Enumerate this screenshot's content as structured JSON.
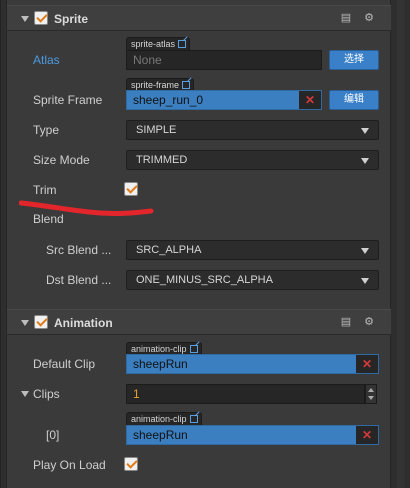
{
  "sprite": {
    "title": "Sprite",
    "book_icon": "book-icon",
    "gear_icon": "gear-icon",
    "atlas": {
      "label": "Atlas",
      "tag": "sprite-atlas",
      "placeholder": "None",
      "button": "选择"
    },
    "sprite_frame": {
      "label": "Sprite Frame",
      "tag": "sprite-frame",
      "value": "sheep_run_0",
      "button": "编辑"
    },
    "type": {
      "label": "Type",
      "value": "SIMPLE"
    },
    "size_mode": {
      "label": "Size Mode",
      "value": "TRIMMED"
    },
    "trim": {
      "label": "Trim",
      "checked": true
    },
    "blend": {
      "label": "Blend"
    },
    "src_blend": {
      "label": "Src Blend ...",
      "value": "SRC_ALPHA"
    },
    "dst_blend": {
      "label": "Dst Blend ...",
      "value": "ONE_MINUS_SRC_ALPHA"
    }
  },
  "animation": {
    "title": "Animation",
    "default_clip": {
      "label": "Default Clip",
      "tag": "animation-clip",
      "value": "sheepRun"
    },
    "clips": {
      "label": "Clips",
      "count": "1"
    },
    "clip_0": {
      "label": "[0]",
      "tag": "animation-clip",
      "value": "sheepRun"
    },
    "play_on_load": {
      "label": "Play On Load",
      "checked": true
    }
  },
  "colors": {
    "accent_blue": "#3a80c9",
    "checkbox_orange": "#e07b1a",
    "annotation_red": "#e3262b"
  }
}
